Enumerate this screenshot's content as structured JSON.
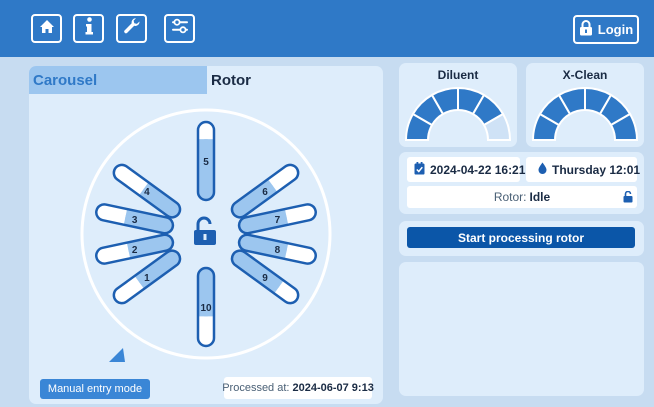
{
  "toolbar": {
    "home_icon": "home-icon",
    "info_icon": "info-icon",
    "tools_icon": "wrench-icon",
    "settings_icon": "sliders-icon",
    "login_label": "Login"
  },
  "tabs": {
    "carousel": "Carousel",
    "rotor": "Rotor"
  },
  "rotor": {
    "positions": [
      {
        "label": "1",
        "fill": 0.62
      },
      {
        "label": "2",
        "fill": 0.58
      },
      {
        "label": "3",
        "fill": 0.62
      },
      {
        "label": "4",
        "fill": 0.55
      },
      {
        "label": "5",
        "fill": 0.78
      },
      {
        "label": "6",
        "fill": 0.62
      },
      {
        "label": "7",
        "fill": 0.62
      },
      {
        "label": "8",
        "fill": 0.62
      },
      {
        "label": "9",
        "fill": 0.72
      },
      {
        "label": "10",
        "fill": 0.62
      }
    ],
    "lock_state": "unlocked"
  },
  "gauges": [
    {
      "title": "Diluent",
      "segments_filled": 5,
      "segments_total": 6
    },
    {
      "title": "X-Clean",
      "segments_filled": 6,
      "segments_total": 6
    }
  ],
  "info": {
    "date": "2024-04-22 16:21",
    "day_time": "Thursday 12:01",
    "rotor_status_label": "Rotor:",
    "rotor_status_value": "Idle"
  },
  "actions": {
    "start_label": "Start processing rotor",
    "manual_label": "Manual entry mode"
  },
  "processed": {
    "label": "Processed at:",
    "value": "2024-06-07 9:13"
  },
  "colors": {
    "header": "#2f79c7",
    "primary_dark": "#0b56a8",
    "gauge_fill": "#2f79c7",
    "gauge_empty": "#cfe2f6",
    "tube_fill": "#9cc6ef",
    "tube_outline": "#1d5fb1",
    "panel": "#deedfb",
    "background": "#c7dcf1"
  }
}
